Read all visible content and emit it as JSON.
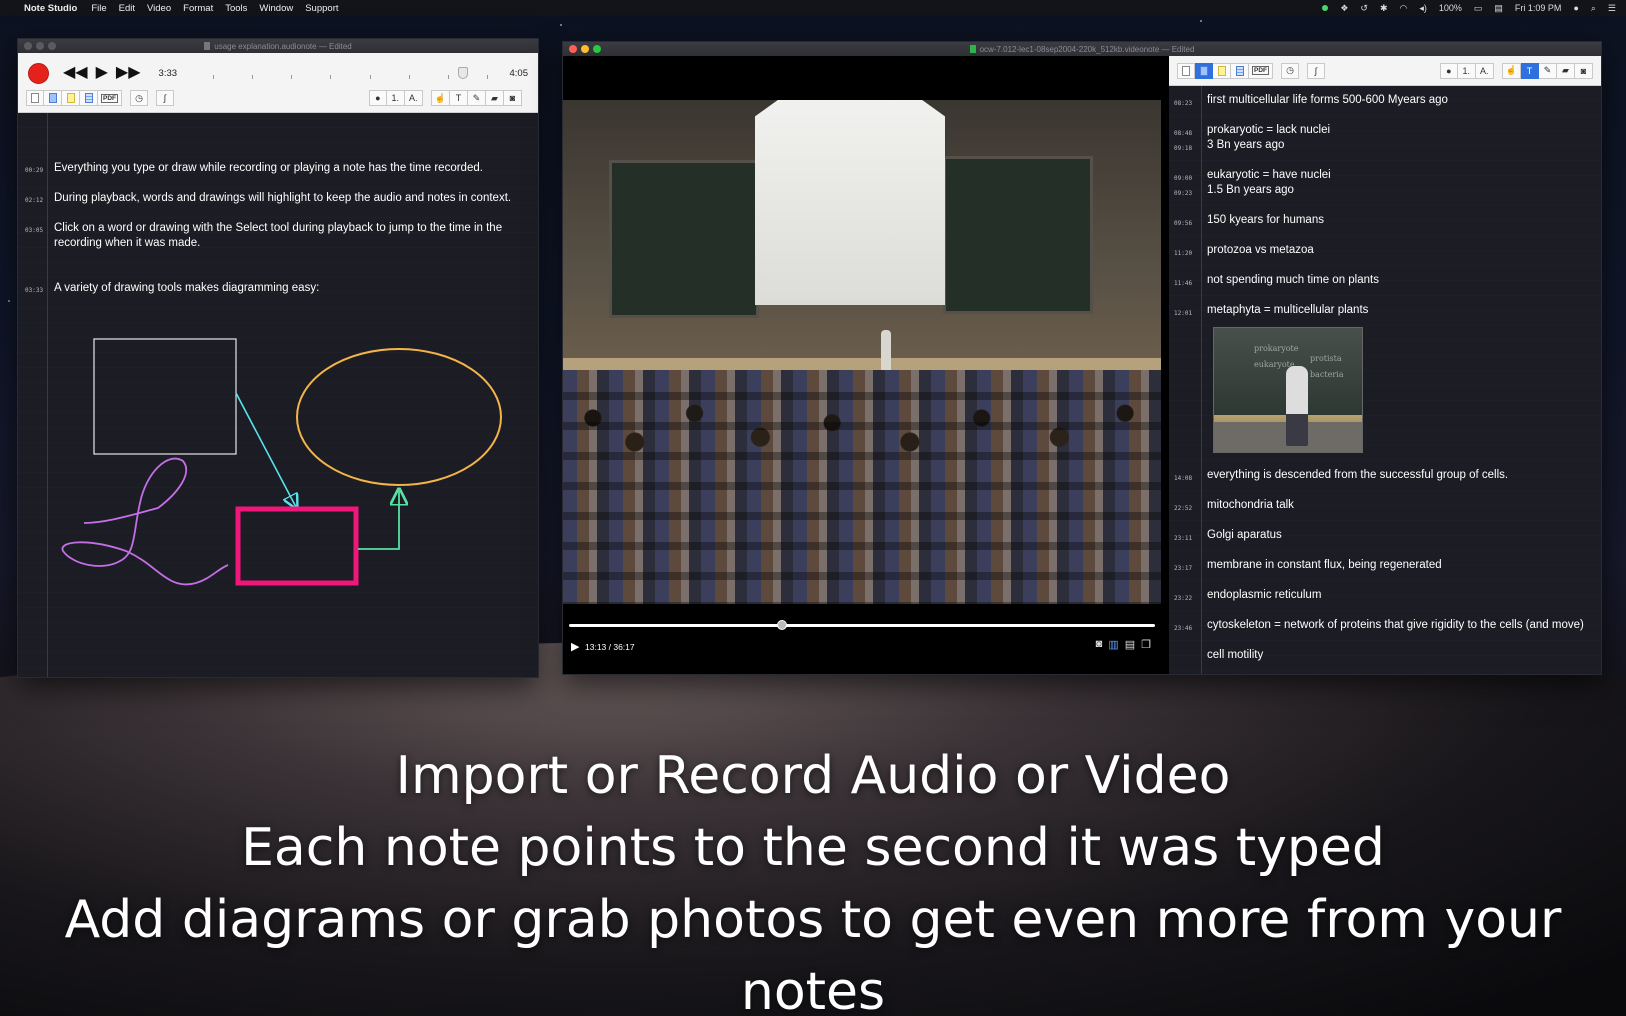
{
  "menubar": {
    "app_name": "Note Studio",
    "items": [
      "File",
      "Edit",
      "Video",
      "Format",
      "Tools",
      "Window",
      "Support"
    ],
    "battery": "100%",
    "clock": "Fri 1:09 PM"
  },
  "audio_window": {
    "title": "usage explanation.audionote — Edited",
    "current_time": "3:33",
    "end_time": "4:05",
    "tools": {
      "pdf": "PDF",
      "numbered": "1.",
      "font": "A.",
      "text": "T"
    },
    "notes": [
      {
        "ts": "00:29",
        "text": "Everything you type or draw while recording or playing a note has the time recorded."
      },
      {
        "ts": "02:12",
        "text": "During playback, words and drawings will highlight to keep the audio and notes in context."
      },
      {
        "ts": "03:05",
        "text": "Click on a word or drawing with the Select tool during playback to jump to the time in the recording when it was made."
      },
      {
        "ts": "03:33",
        "text": "A variety of drawing tools makes diagramming easy:"
      }
    ],
    "colors": {
      "white_rect": "#e8e8e8",
      "cyan_arrow": "#57e3ee",
      "orange_ellipse": "#f3b548",
      "magenta_rect": "#f0167a",
      "green_arrow": "#58e0a5",
      "purple_curve": "#c46fe6"
    }
  },
  "video_window": {
    "title": "ocw-7.012-lec1-08sep2004-220k_512kb.videonote — Edited",
    "time_display": "13:13 / 36:17",
    "progress_fraction": 0.364,
    "tools": {
      "pdf": "PDF",
      "numbered": "1.",
      "font": "A.",
      "text": "T"
    },
    "notes": [
      {
        "ts": "08:23",
        "text": "first multicellular life forms 500-600 Myears ago"
      },
      {
        "ts": "08:48",
        "text": "prokaryotic = lack nuclei"
      },
      {
        "ts": "09:18",
        "text": "3 Bn years ago"
      },
      {
        "ts": "09:00",
        "text": "eukaryotic = have nuclei"
      },
      {
        "ts": "09:23",
        "text": "1.5 Bn years ago"
      },
      {
        "ts": "09:56",
        "text": "150 kyears for humans"
      },
      {
        "ts": "11:20",
        "text": "protozoa vs metazoa"
      },
      {
        "ts": "11:46",
        "text": "not spending much time on plants"
      },
      {
        "ts": "12:01",
        "text": "metaphyta = multicellular plants"
      },
      {
        "ts": "14:08",
        "text": "everything is descended from the successful group of cells."
      },
      {
        "ts": "22:52",
        "text": "mitochondria talk"
      },
      {
        "ts": "23:11",
        "text": "Golgi aparatus"
      },
      {
        "ts": "23:17",
        "text": "membrane in constant flux, being regenerated"
      },
      {
        "ts": "23:22",
        "text": "endoplasmic reticulum"
      },
      {
        "ts": "23:46",
        "text": "cytoskeleton = network of proteins that give rigidity to the cells (and move)"
      },
      {
        "ts": "",
        "text": "cell motility"
      }
    ],
    "photo_chalk": {
      "line1": "prokaryote",
      "line2": "eukaryote",
      "line3": "protista",
      "line4": "bacteria"
    }
  },
  "headline": {
    "line1": "Import or Record Audio or Video",
    "line2": "Each note points to the second it was typed",
    "line3": "Add diagrams or grab photos to get even more from your notes"
  }
}
